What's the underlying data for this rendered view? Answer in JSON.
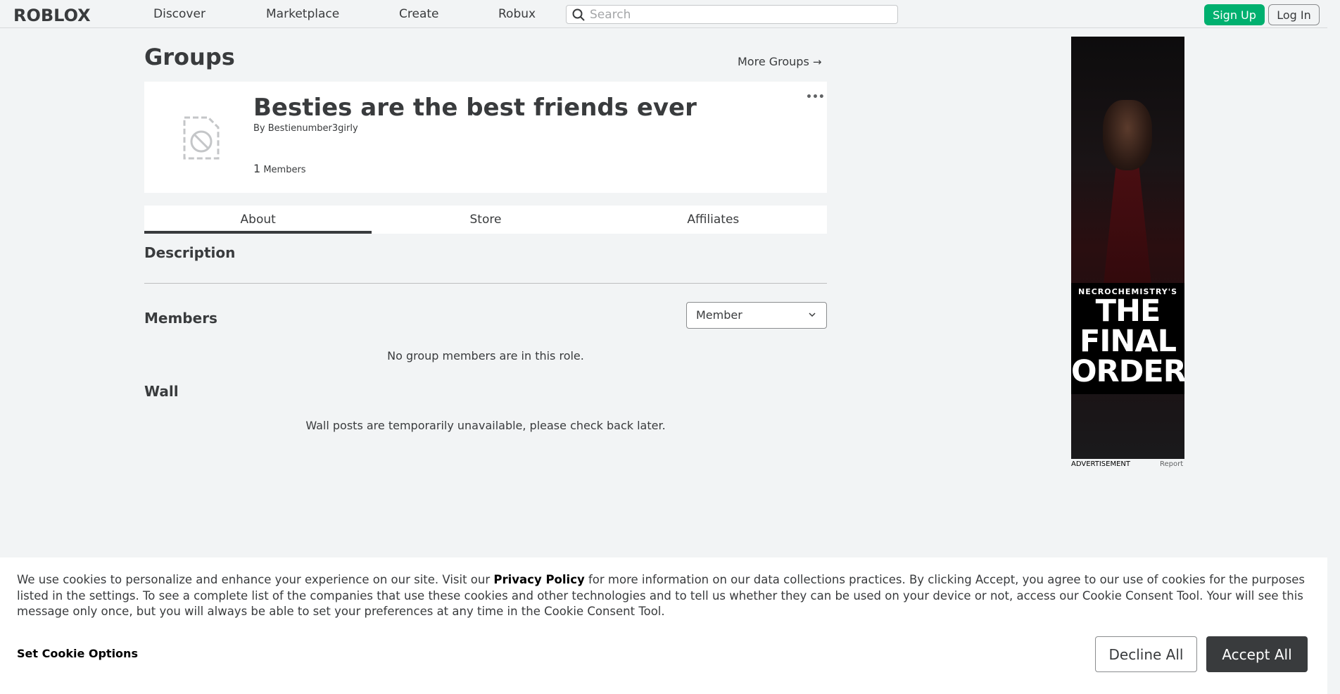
{
  "header": {
    "logo": "ROBLOX",
    "nav": [
      "Discover",
      "Marketplace",
      "Create",
      "Robux"
    ],
    "search_placeholder": "Search",
    "signup_label": "Sign Up",
    "login_label": "Log In"
  },
  "page": {
    "title": "Groups",
    "more_groups": "More Groups"
  },
  "group": {
    "name": "Besties are the best friends ever",
    "by_prefix": "By",
    "owner": "Bestienumber3girly",
    "member_count": "1",
    "member_label": "Members",
    "more_menu": "•••"
  },
  "tabs": [
    "About",
    "Store",
    "Affiliates"
  ],
  "about": {
    "description_title": "Description",
    "members_title": "Members",
    "role_selected": "Member",
    "members_empty": "No group members are in this role.",
    "wall_title": "Wall",
    "wall_empty": "Wall posts are temporarily unavailable, please check back later."
  },
  "ad": {
    "subtitle": "NECROCHEMISTRY'S",
    "line1": "THE",
    "line2": "FINAL",
    "line3": "ORDER",
    "label": "ADVERTISEMENT",
    "report": "Report"
  },
  "cookie": {
    "text_before": "We use cookies to personalize and enhance your experience on our site. Visit our ",
    "privacy_link": "Privacy Policy",
    "text_after": " for more information on our data collections practices. By clicking Accept, you agree to our use of cookies for the purposes listed in the settings. To see a complete list of the companies that use these cookies and other technologies and to tell us whether they can be used on your device or not, access our Cookie Consent Tool. Your will see this message only once, but you will always be able to set your preferences at any time in the Cookie Consent Tool.",
    "options_label": "Set Cookie Options",
    "decline_label": "Decline All",
    "accept_label": "Accept All"
  },
  "colors": {
    "signup_green": "#00b06f",
    "background": "#f2f4f5",
    "text": "#393b3d"
  }
}
